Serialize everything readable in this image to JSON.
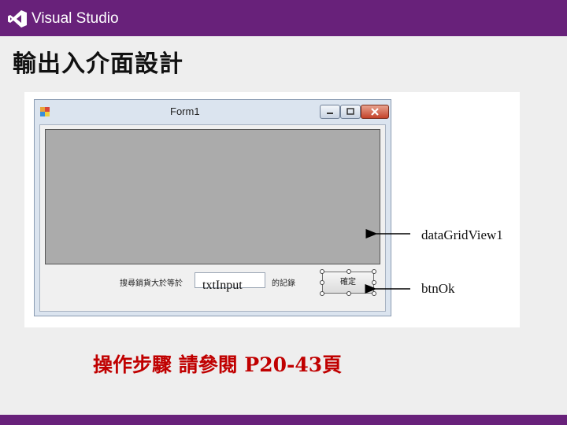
{
  "header": {
    "brand": "Visual Studio"
  },
  "slide": {
    "title": "輸出入介面設計",
    "steps_text": "操作步驟 請參閱 P20-43頁"
  },
  "form": {
    "title": "Form1",
    "label_before": "搜尋銷貨大於等於",
    "input_name": "txtInput",
    "label_after": "的記錄",
    "button_label": "確定"
  },
  "annotations": {
    "grid": "dataGridView1",
    "button": "btnOk"
  },
  "colors": {
    "brand_purple": "#68217a",
    "grid_gray": "#ababab",
    "steps_red": "#c00000"
  }
}
